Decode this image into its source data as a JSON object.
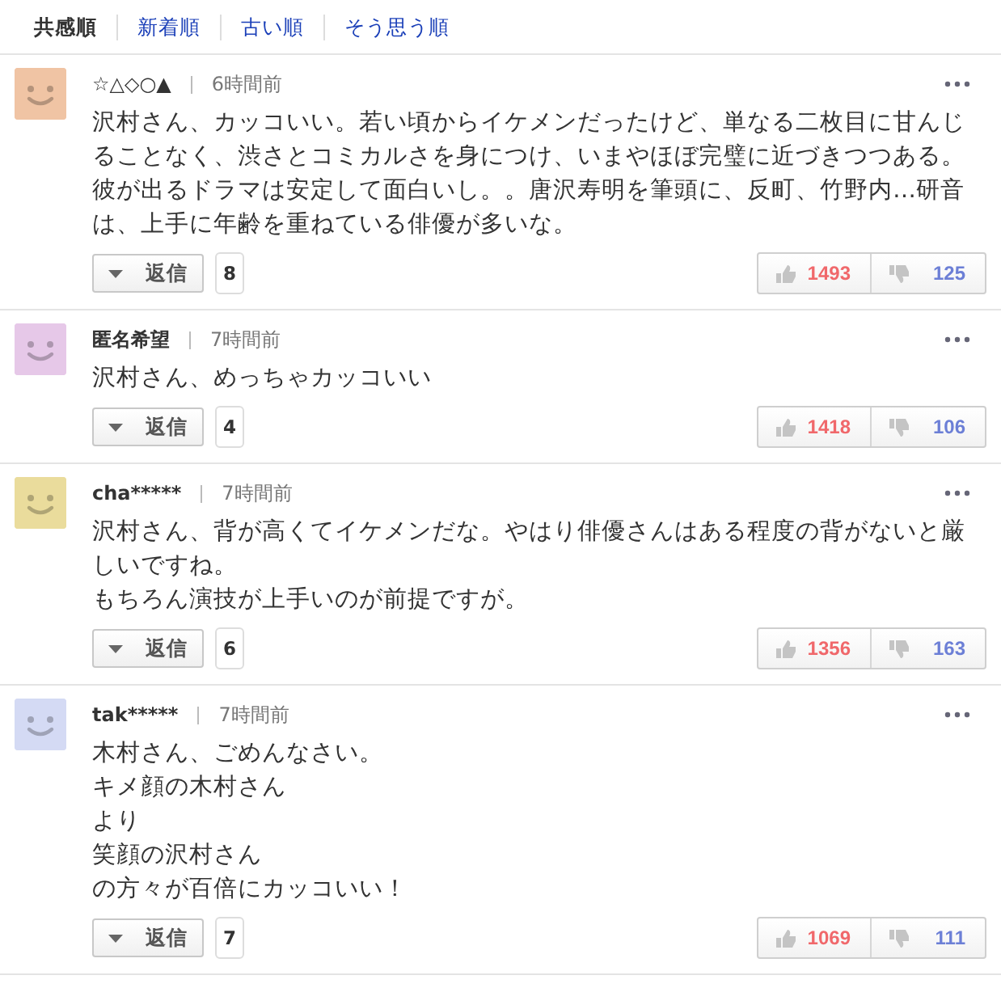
{
  "sort_tabs": [
    {
      "label": "共感順",
      "selected": true
    },
    {
      "label": "新着順",
      "selected": false
    },
    {
      "label": "古い順",
      "selected": false
    },
    {
      "label": "そう思う順",
      "selected": false
    }
  ],
  "comments": [
    {
      "author": "☆△◇○▲",
      "time": "6時間前",
      "color": "#f0c4a4",
      "lines": [
        "沢村さん、カッコいい。若い頃からイケメンだったけど、単なる二枚目に甘んじ",
        "ることなく、渋さとコミカルさを身につけ、いまやほぼ完璧に近づきつつある。",
        "彼が出るドラマは安定して面白いし。。唐沢寿明を筆頭に、反町、竹野内…研音",
        "は、上手に年齢を重ねている俳優が多いな。"
      ],
      "reply_label": "返信",
      "reply_count": "8",
      "likes": "1493",
      "dislikes": "125"
    },
    {
      "author": "匿名希望",
      "time": "7時間前",
      "color": "#e6c8e8",
      "lines": [
        "沢村さん、めっちゃカッコいい"
      ],
      "reply_label": "返信",
      "reply_count": "4",
      "likes": "1418",
      "dislikes": "106"
    },
    {
      "author": "cha*****",
      "time": "7時間前",
      "color": "#eadc9c",
      "lines": [
        "沢村さん、背が高くてイケメンだな。やはり俳優さんはある程度の背がないと厳",
        "しいですね。",
        "もちろん演技が上手いのが前提ですが。"
      ],
      "reply_label": "返信",
      "reply_count": "6",
      "likes": "1356",
      "dislikes": "163"
    },
    {
      "author": "tak*****",
      "time": "7時間前",
      "color": "#d4daf4",
      "lines": [
        "木村さん、ごめんなさい。",
        "キメ顔の木村さん",
        "より",
        "笑顔の沢村さん",
        "の方々が百倍にカッコいい！"
      ],
      "reply_label": "返信",
      "reply_count": "7",
      "likes": "1069",
      "dislikes": "111"
    }
  ]
}
